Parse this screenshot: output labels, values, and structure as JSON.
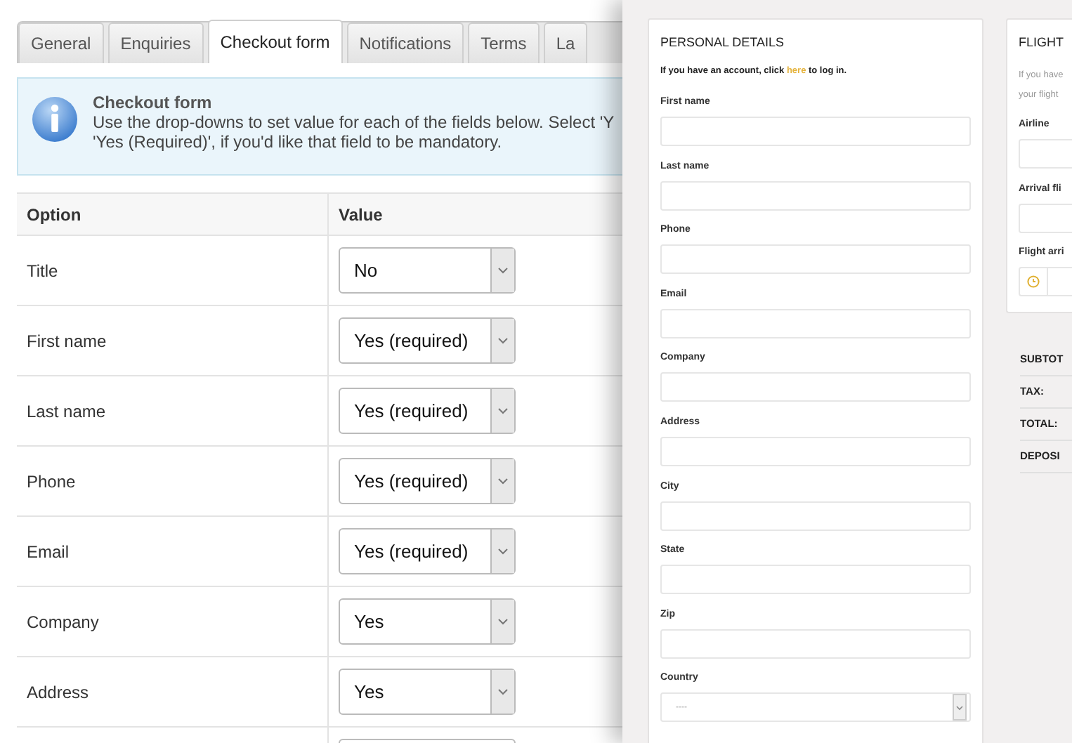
{
  "tabs": [
    {
      "label": "General",
      "selected": false
    },
    {
      "label": "Enquiries",
      "selected": false
    },
    {
      "label": "Checkout form",
      "selected": true
    },
    {
      "label": "Notifications",
      "selected": false
    },
    {
      "label": "Terms",
      "selected": false
    },
    {
      "label": "La",
      "selected": false
    }
  ],
  "info": {
    "title": "Checkout form",
    "lines": [
      "Use the drop-downs to set value for each of the fields below. Select 'Y",
      "'Yes (Required)', if you'd like that field to be mandatory."
    ]
  },
  "table": {
    "columns": [
      "Option",
      "Value"
    ],
    "rows": [
      {
        "option": "Title",
        "value": "No"
      },
      {
        "option": "First name",
        "value": "Yes (required)"
      },
      {
        "option": "Last name",
        "value": "Yes (required)"
      },
      {
        "option": "Phone",
        "value": "Yes (required)"
      },
      {
        "option": "Email",
        "value": "Yes (required)"
      },
      {
        "option": "Company",
        "value": "Yes"
      },
      {
        "option": "Address",
        "value": "Yes"
      }
    ]
  },
  "preview": {
    "personal": {
      "title": "PERSONAL DETAILS",
      "login_before": "If you have an account, click",
      "login_link": "here",
      "login_after": "to log in.",
      "fields": [
        {
          "label": "First name",
          "kind": "text"
        },
        {
          "label": "Last name",
          "kind": "text"
        },
        {
          "label": "Phone",
          "kind": "text"
        },
        {
          "label": "Email",
          "kind": "text"
        },
        {
          "label": "Company",
          "kind": "text"
        },
        {
          "label": "Address",
          "kind": "text"
        },
        {
          "label": "City",
          "kind": "text"
        },
        {
          "label": "State",
          "kind": "text"
        },
        {
          "label": "Zip",
          "kind": "text"
        },
        {
          "label": "Country",
          "kind": "select",
          "value": "----"
        }
      ]
    },
    "flight": {
      "title": "FLIGHT",
      "lines": [
        "If you have",
        "your flight"
      ],
      "fields": [
        {
          "label": "Airline",
          "kind": "text"
        },
        {
          "label": "Arrival fli",
          "kind": "text"
        },
        {
          "label": "Flight arri",
          "kind": "time"
        }
      ]
    },
    "totals": [
      "SUBTOT",
      "TAX:",
      "TOTAL:",
      "DEPOSI"
    ]
  }
}
